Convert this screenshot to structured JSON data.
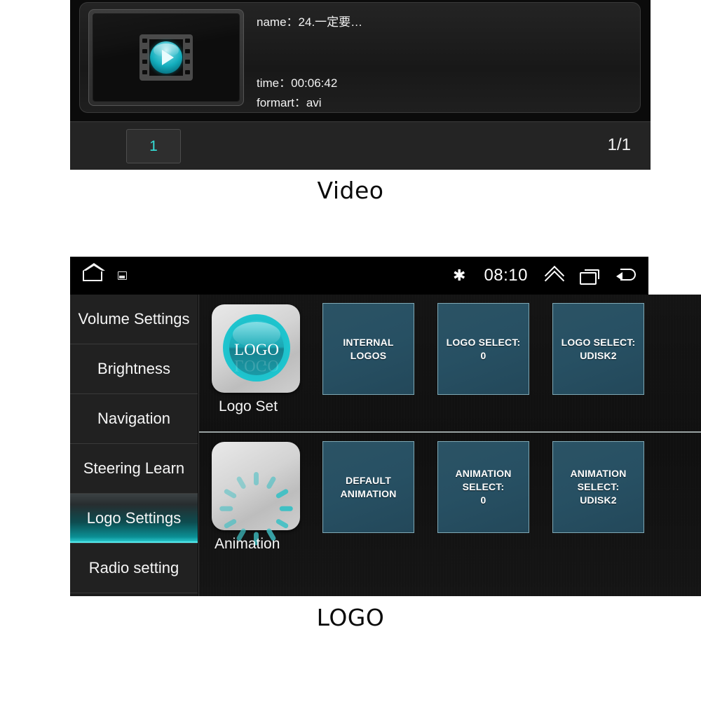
{
  "video_panel": {
    "item": {
      "name_label": "name：",
      "name_value": "24.一定要…",
      "time_label": "time：",
      "time_value": "00:06:42",
      "format_label": "formart：",
      "format_value": "avi",
      "thumbnail_icon": "film-play-icon"
    },
    "toolbar": {
      "page_button": "1",
      "page_indicator": "1/1"
    }
  },
  "video_caption": "Video",
  "logo_caption": "LOGO",
  "logo_panel": {
    "statusbar": {
      "home_icon": "home-icon",
      "screenshot_icon": "screenshot-icon",
      "bluetooth_icon": "bluetooth-icon",
      "bluetooth_glyph": "✱",
      "time": "08:10",
      "chevron_up_icon": "chevron-double-up-icon",
      "recents_icon": "recents-icon",
      "back_icon": "back-icon"
    },
    "sidebar": {
      "items": [
        {
          "label": "Volume Settings",
          "active": false
        },
        {
          "label": "Brightness",
          "active": false
        },
        {
          "label": "Navigation",
          "active": false
        },
        {
          "label": "Steering Learn",
          "active": false
        },
        {
          "label": "Logo Settings",
          "active": true
        },
        {
          "label": "Radio setting",
          "active": false
        }
      ],
      "active_index": 4
    },
    "sections": [
      {
        "app_icon": "logo-circle-icon",
        "app_icon_text": "LOGO",
        "app_label": "Logo Set",
        "options": [
          {
            "lines": [
              "INTERNAL LOGOS"
            ]
          },
          {
            "lines": [
              "LOGO SELECT:",
              "0"
            ]
          },
          {
            "lines": [
              "LOGO SELECT:",
              "UDISK2"
            ]
          }
        ]
      },
      {
        "app_icon": "spinner-icon",
        "app_label": "Animation",
        "options": [
          {
            "lines": [
              "DEFAULT",
              "ANIMATION"
            ]
          },
          {
            "lines": [
              "ANIMATION",
              "SELECT:",
              "0"
            ]
          },
          {
            "lines": [
              "ANIMATION",
              "SELECT:",
              "UDISK2"
            ]
          }
        ]
      }
    ]
  },
  "colors": {
    "accent_teal": "#35e0d8",
    "tile_fill": "#275063",
    "tile_border": "#7fa8b4",
    "panel_bg": "#0a0a0a",
    "sidebar_bg": "#212121",
    "text_primary": "#f5f5f5"
  }
}
